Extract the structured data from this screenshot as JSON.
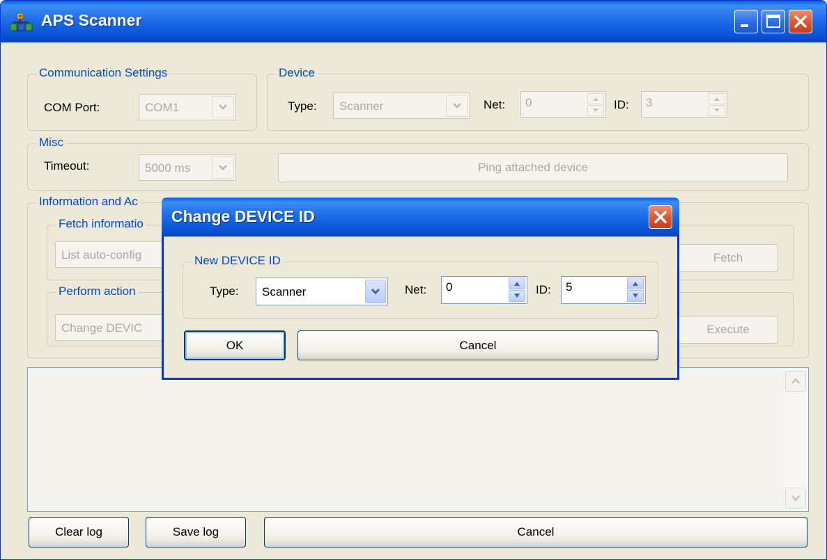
{
  "window": {
    "title": "APS Scanner",
    "icons": {
      "app": "app-icon",
      "minimize": "minimize-icon",
      "maximize": "maximize-icon",
      "close": "close-icon"
    }
  },
  "comm": {
    "group_title": "Communication Settings",
    "com_port_label": "COM Port:",
    "com_port_value": "COM1"
  },
  "device": {
    "group_title": "Device",
    "type_label": "Type:",
    "type_value": "Scanner",
    "net_label": "Net:",
    "net_value": "0",
    "id_label": "ID:",
    "id_value": "3"
  },
  "misc": {
    "group_title": "Misc",
    "timeout_label": "Timeout:",
    "timeout_value": "5000 ms",
    "ping_button": "Ping attached device"
  },
  "info": {
    "group_title": "Information and Ac",
    "fetch_group_title": "Fetch informatio",
    "fetch_select_value": "List auto-config",
    "fetch_button": "Fetch",
    "action_group_title": "Perform action",
    "action_select_value": "Change DEVIC",
    "execute_button": "Execute"
  },
  "log": {
    "text": ""
  },
  "bottom": {
    "clear_log": "Clear log",
    "save_log": "Save log",
    "cancel": "Cancel"
  },
  "dialog": {
    "title": "Change DEVICE ID",
    "group_title": "New DEVICE ID",
    "type_label": "Type:",
    "type_value": "Scanner",
    "net_label": "Net:",
    "net_value": "0",
    "id_label": "ID:",
    "id_value": "5",
    "ok_button": "OK",
    "cancel_button": "Cancel"
  },
  "colors": {
    "title_blue": "#0a55d8",
    "group_title": "#0046d5",
    "face": "#ece9d8",
    "close_red": "#e0532f"
  }
}
